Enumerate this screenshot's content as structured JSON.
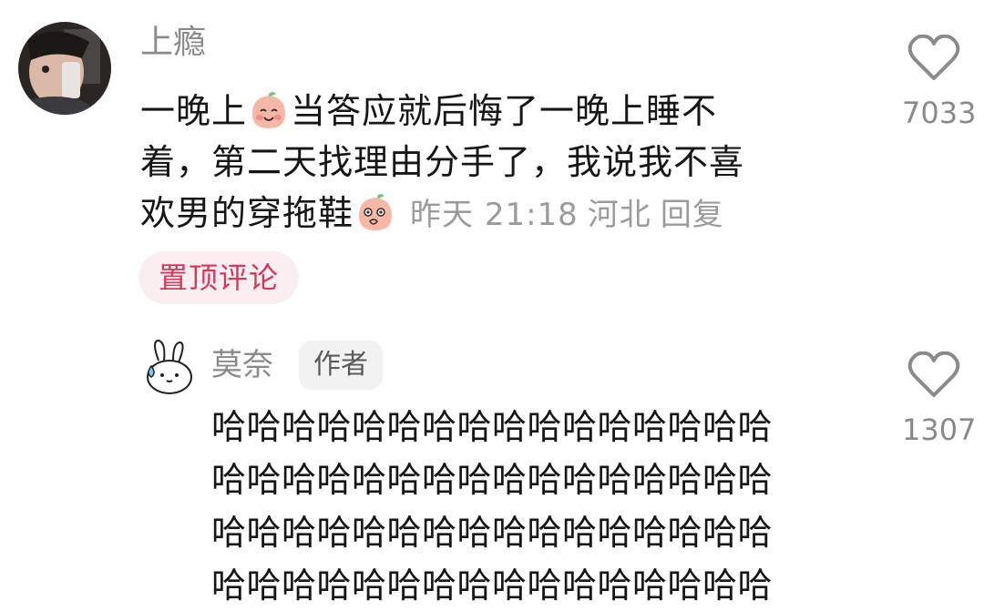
{
  "main_comment": {
    "username": "上瘾",
    "text_lines": [
      {
        "before": "一晚上",
        "after": "当答应就后悔了一晚上睡不"
      },
      {
        "text": "着，第二天找理由分手了，我说我不喜"
      },
      {
        "text": "欢男的穿拖鞋"
      }
    ],
    "emoji_1": "smile-peach-icon",
    "emoji_2": "thinking-peach-icon",
    "time": "昨天 21:18",
    "location": "河北",
    "reply_label": "回复",
    "pinned_label": "置顶评论",
    "likes": "7033"
  },
  "reply": {
    "username": "莫奈",
    "author_badge": "作者",
    "text_lines": [
      "哈哈哈哈哈哈哈哈哈哈哈哈哈哈哈哈",
      "哈哈哈哈哈哈哈哈哈哈哈哈哈哈哈哈",
      "哈哈哈哈哈哈哈哈哈哈哈哈哈哈哈哈",
      "哈哈哈哈哈哈哈哈哈哈哈哈哈哈哈哈"
    ],
    "likes": "1307"
  },
  "colors": {
    "pinned_bg": "#fbeef0",
    "pinned_text": "#d6385a",
    "muted": "#8a8a8a",
    "text": "#161616"
  }
}
